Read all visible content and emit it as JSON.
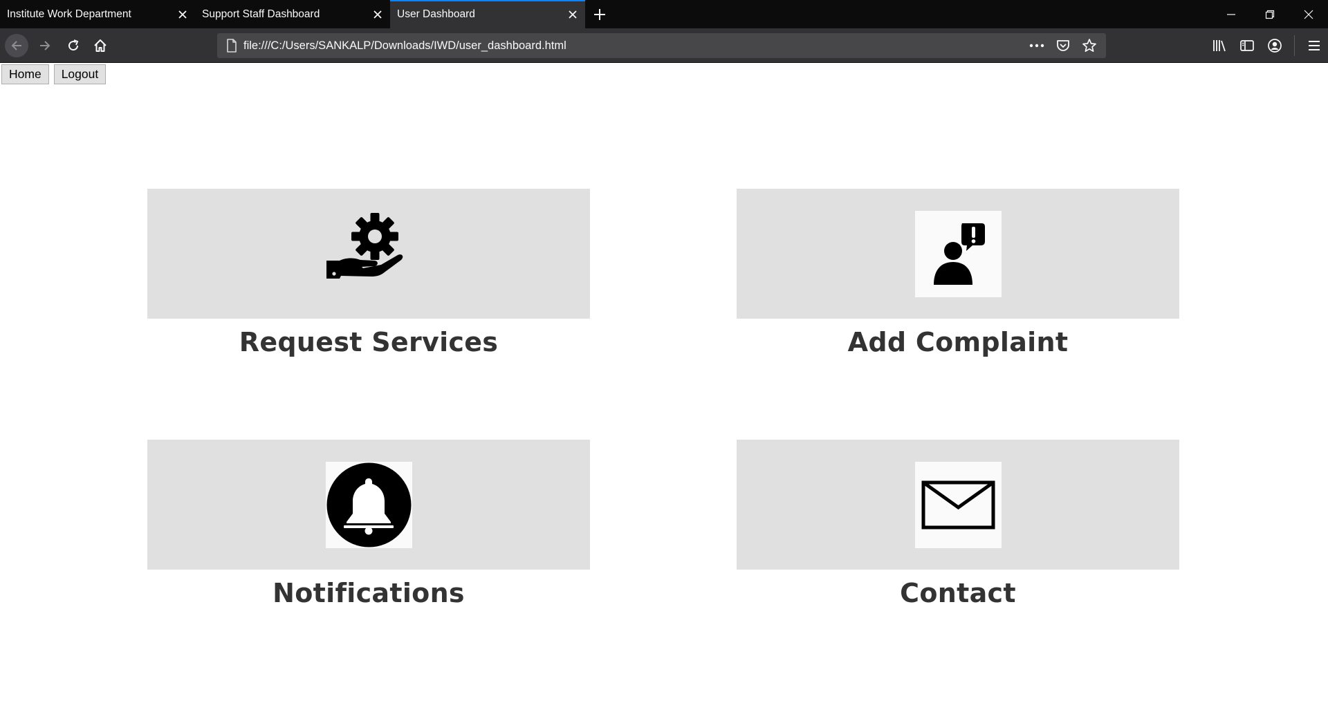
{
  "browser": {
    "tabs": [
      {
        "title": "Institute Work Department",
        "active": false
      },
      {
        "title": "Support Staff Dashboard",
        "active": false
      },
      {
        "title": "User Dashboard",
        "active": true
      }
    ],
    "url": "file:///C:/Users/SANKALP/Downloads/IWD/user_dashboard.html",
    "accent_color": "#0a84ff"
  },
  "page": {
    "top_buttons": {
      "home_label": "Home",
      "logout_label": "Logout"
    },
    "cards": [
      {
        "label": "Request Services",
        "icon": "gear-in-hand-icon"
      },
      {
        "label": "Add Complaint",
        "icon": "person-alert-icon"
      },
      {
        "label": "Notifications",
        "icon": "bell-icon"
      },
      {
        "label": "Contact",
        "icon": "envelope-icon"
      }
    ],
    "panel_color": "#e0e0e0",
    "label_color": "#333333"
  }
}
